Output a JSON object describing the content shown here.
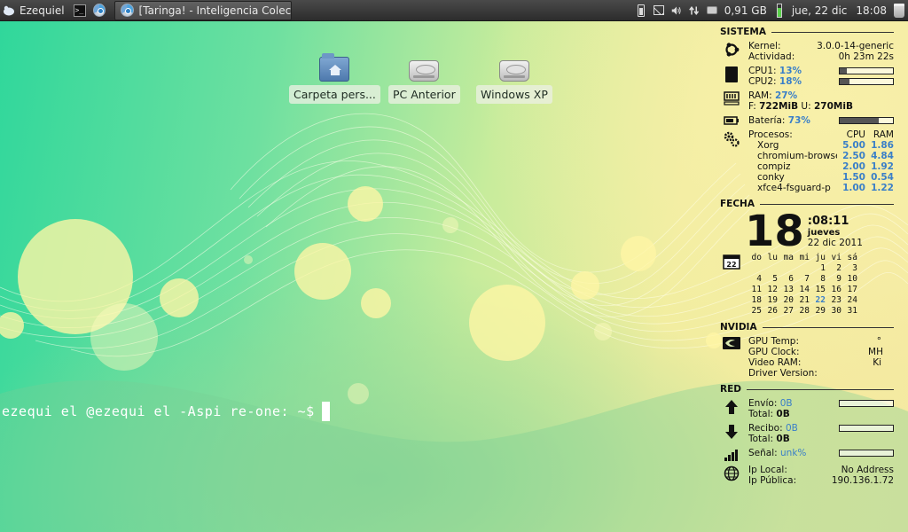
{
  "panel": {
    "menu_label": "Ezequiel",
    "task_title": "[Taringa! - Inteligencia Colec...",
    "disk_free": "0,91 GB",
    "date": "jue, 22 dic",
    "time": "18:08"
  },
  "desktop": {
    "icons": [
      {
        "label": "Carpeta pers...",
        "icon": "home-folder-icon"
      },
      {
        "label": "PC Anterior",
        "icon": "hard-drive-icon"
      },
      {
        "label": "Windows XP",
        "icon": "hard-drive-icon"
      }
    ]
  },
  "terminal": {
    "prompt": "ezequi el @ezequi el -Aspi re-one: ~$"
  },
  "conky": {
    "sistema": {
      "header": "SISTEMA",
      "kernel_label": "Kernel:",
      "kernel_value": "3.0.0-14-generic",
      "uptime_label": "Actividad:",
      "uptime_value": "0h 23m 22s",
      "cpu1_label": "CPU1:",
      "cpu1_value": "13%",
      "cpu1_level": 0.13,
      "cpu2_label": "CPU2:",
      "cpu2_value": "18%",
      "cpu2_level": 0.18,
      "ram_label": "RAM:",
      "ram_value": "27%",
      "ram_free_label": "F:",
      "ram_free": "722MiB",
      "ram_used_label": "U:",
      "ram_used": "270MiB",
      "battery_label": "Batería:",
      "battery_value": "73%",
      "battery_level": 0.73,
      "procs_label": "Procesos:",
      "col_cpu": "CPU",
      "col_ram": "RAM",
      "processes": [
        {
          "name": "Xorg",
          "cpu": "5.00",
          "ram": "1.86"
        },
        {
          "name": "chromium-browse",
          "cpu": "2.50",
          "ram": "4.84"
        },
        {
          "name": "compiz",
          "cpu": "2.00",
          "ram": "1.92"
        },
        {
          "name": "conky",
          "cpu": "1.50",
          "ram": "0.54"
        },
        {
          "name": "xfce4-fsguard-p",
          "cpu": "1.00",
          "ram": "1.22"
        }
      ]
    },
    "fecha": {
      "header": "FECHA",
      "day_number": "18",
      "time": ":08:11",
      "weekday": "jueves",
      "date": "22 dic 2011",
      "calendar_badge": "22",
      "weekdays": [
        "do",
        "lu",
        "ma",
        "mi",
        "ju",
        "vi",
        "sá"
      ],
      "weeks": [
        [
          "",
          "",
          "",
          "",
          "1",
          "2",
          "3"
        ],
        [
          "4",
          "5",
          "6",
          "7",
          "8",
          "9",
          "10"
        ],
        [
          "11",
          "12",
          "13",
          "14",
          "15",
          "16",
          "17"
        ],
        [
          "18",
          "19",
          "20",
          "21",
          "22",
          "23",
          "24"
        ],
        [
          "25",
          "26",
          "27",
          "28",
          "29",
          "30",
          "31"
        ]
      ],
      "today": "22"
    },
    "nvidia": {
      "header": "NVIDIA",
      "gpu_temp_label": "GPU Temp:",
      "gpu_temp_value": "°",
      "gpu_clock_label": "GPU Clock:",
      "gpu_clock_value": "MH",
      "vram_label": "Video RAM:",
      "vram_value": "Ki",
      "driver_label": "Driver Version:",
      "driver_value": ""
    },
    "red": {
      "header": "RED",
      "send_label": "Envío:",
      "send_value": "0B",
      "send_total_label": "Total:",
      "send_total": "0B",
      "recv_label": "Recibo:",
      "recv_value": "0B",
      "recv_total_label": "Total:",
      "recv_total": "0B",
      "signal_label": "Señal:",
      "signal_value": "unk%",
      "ip_local_label": "Ip Local:",
      "ip_local": "No Address",
      "ip_public_label": "Ip Pública:",
      "ip_public": "190.136.1.72"
    }
  }
}
